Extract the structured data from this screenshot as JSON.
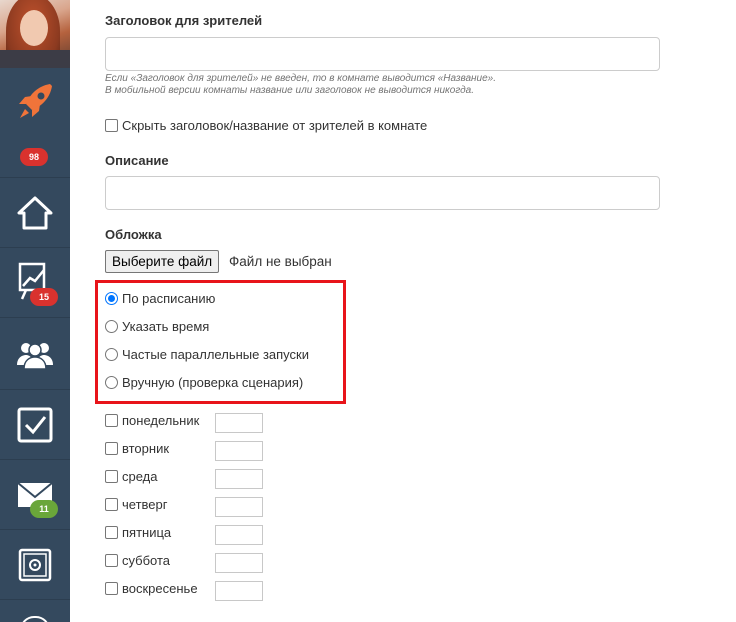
{
  "sidebar": {
    "badges": {
      "rocket": "98",
      "stats": "15",
      "mail": "11"
    },
    "colors": {
      "background": "#34495e",
      "rocket": "#f0743a",
      "badge_red": "#d9322e",
      "badge_green": "#6aa63a"
    }
  },
  "form": {
    "viewer_title": {
      "label": "Заголовок для зрителей",
      "value": "",
      "hint_line1": "Если «Заголовок для зрителей» не введен, то в комнате выводится «Название».",
      "hint_line2": "В мобильной версии комнаты название или заголовок не выводится никогда."
    },
    "hide_title_label": "Скрыть заголовок/название от зрителей в комнате",
    "description": {
      "label": "Описание",
      "value": ""
    },
    "cover": {
      "label": "Обложка",
      "choose_button": "Выберите файл",
      "status": "Файл не выбран"
    },
    "schedule_options": [
      {
        "label": "По расписанию",
        "checked": true
      },
      {
        "label": "Указать время",
        "checked": false
      },
      {
        "label": "Частые параллельные запуски",
        "checked": false
      },
      {
        "label": "Вручную (проверка сценария)",
        "checked": false
      }
    ],
    "days": [
      {
        "label": "понедельник",
        "value": ""
      },
      {
        "label": "вторник",
        "value": ""
      },
      {
        "label": "среда",
        "value": ""
      },
      {
        "label": "четверг",
        "value": ""
      },
      {
        "label": "пятница",
        "value": ""
      },
      {
        "label": "суббота",
        "value": ""
      },
      {
        "label": "воскресенье",
        "value": ""
      }
    ],
    "highlight_color": "#e8141a"
  }
}
